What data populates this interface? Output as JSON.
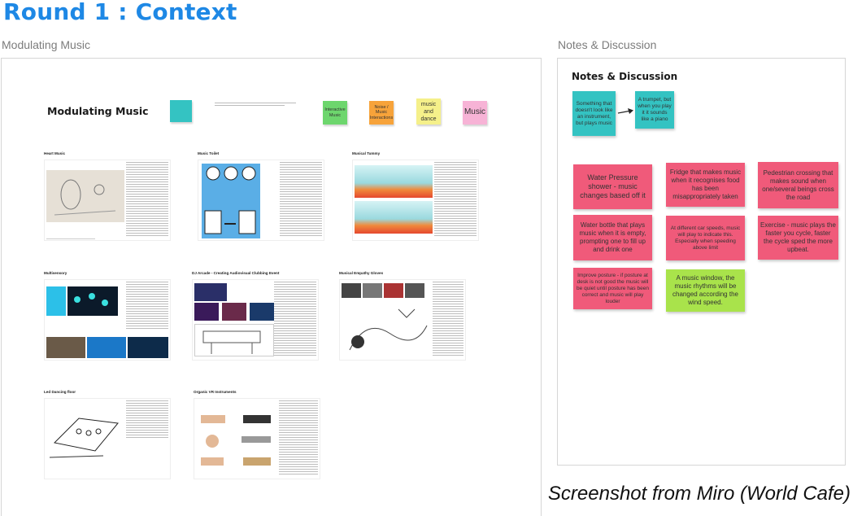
{
  "page_title": "Round 1 : Context",
  "left_label": "Modulating Music",
  "right_label": "Notes & Discussion",
  "left_board": {
    "heading": "Modulating Music",
    "legend": [
      {
        "text": "Interactive Music",
        "color": "#6dd66d"
      },
      {
        "text": "Noise / Music Interactions",
        "color": "#f7a33a"
      },
      {
        "text": "music and dance",
        "color": "#f5f08a"
      },
      {
        "text": "Music",
        "color": "#f7b3d6"
      }
    ],
    "frames": [
      {
        "title": "Heart Music"
      },
      {
        "title": "Music Toilet"
      },
      {
        "title": "Musical Tummy"
      },
      {
        "title": "Multisensory"
      },
      {
        "title": "DJ Arcade - Creating Audiovisual Clubbing Event"
      },
      {
        "title": "Musical Empathy Gloves"
      },
      {
        "title": "Led Dancing floor"
      },
      {
        "title": "Organic VR Instruments"
      }
    ]
  },
  "right_board": {
    "heading": "Notes & Discussion",
    "teal_notes": [
      "Something that doesn't look like an instrument, but plays music",
      "A trumpet, but when you play it it sounds like a piano"
    ],
    "notes": [
      {
        "text": "Water Pressure shower - music changes based off it",
        "color": "#f05a7a"
      },
      {
        "text": "Fridge that makes music when it recognises food has been misappropriately taken",
        "color": "#f05a7a"
      },
      {
        "text": "Pedestrian crossing that makes sound when one/several beings cross the road",
        "color": "#f05a7a"
      },
      {
        "text": "Water bottle that plays music when it is empty, prompting one to fill up and drink one",
        "color": "#f05a7a"
      },
      {
        "text": "At different car speeds, music will play to indicate this. Especially when speeding above limit",
        "color": "#f05a7a"
      },
      {
        "text": "Exercise - music plays the faster you cycle, faster the cycle sped the more upbeat.",
        "color": "#f05a7a"
      },
      {
        "text": "Improve posture - if posture at desk is not good the music will be quiet until posture has been correct and music will play louder",
        "color": "#f05a7a"
      },
      {
        "text": "A music window, the music rhythms will be changed according the wind speed.",
        "color": "#a9e34b"
      }
    ]
  },
  "caption": "Screenshot from Miro (World Cafe)"
}
